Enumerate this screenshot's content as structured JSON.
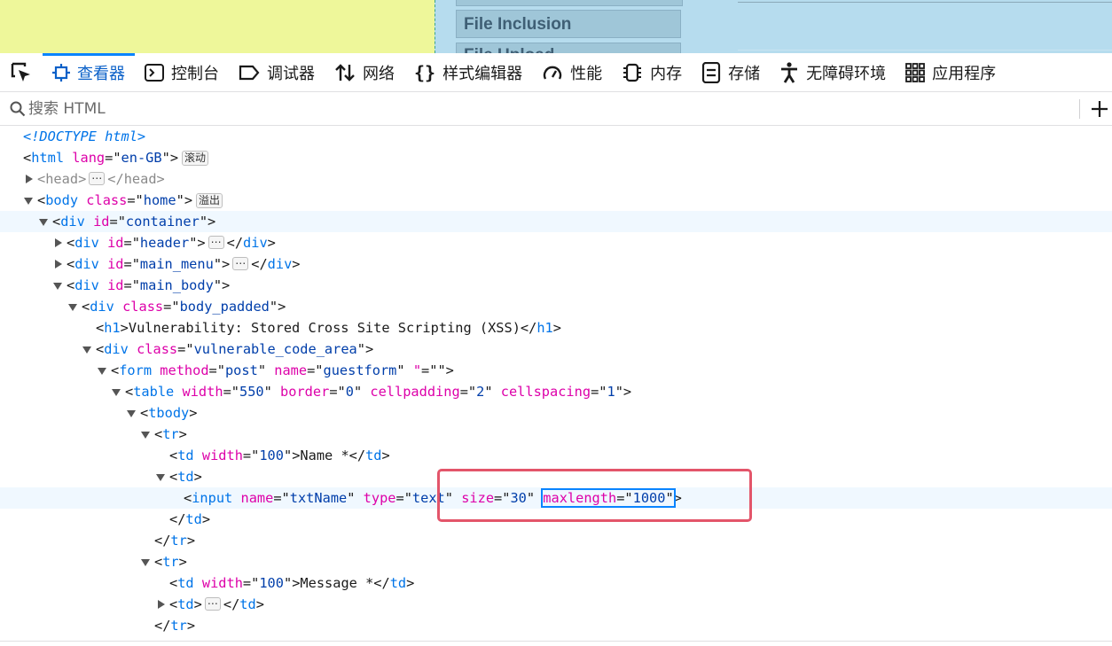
{
  "preview": {
    "menu_item": "File Inclusion",
    "menu_item_next": "File Upload"
  },
  "toolbar": {
    "tabs": [
      {
        "label": "查看器",
        "icon": "inspector-icon",
        "active": true
      },
      {
        "label": "控制台",
        "icon": "console-icon",
        "active": false
      },
      {
        "label": "调试器",
        "icon": "debugger-icon",
        "active": false
      },
      {
        "label": "网络",
        "icon": "network-icon",
        "active": false
      },
      {
        "label": "样式编辑器",
        "icon": "style-editor-icon",
        "active": false
      },
      {
        "label": "性能",
        "icon": "performance-icon",
        "active": false
      },
      {
        "label": "内存",
        "icon": "memory-icon",
        "active": false
      },
      {
        "label": "存储",
        "icon": "storage-icon",
        "active": false
      },
      {
        "label": "无障碍环境",
        "icon": "accessibility-icon",
        "active": false
      },
      {
        "label": "应用程序",
        "icon": "application-icon",
        "active": false
      }
    ]
  },
  "search": {
    "placeholder": "搜索 HTML"
  },
  "badges": {
    "scroll": "滚动",
    "overflow": "溢出",
    "ellipsis": "⋯"
  },
  "colors": {
    "accent": "#0a84ff",
    "tag": "#0074e8",
    "attr_name": "#dd00a9",
    "attr_value": "#003eaa",
    "annotation_box": "#e3556a"
  },
  "tree": {
    "doctype": "<!DOCTYPE html>",
    "html": {
      "tag": "html",
      "attr": "lang",
      "value": "en-GB"
    },
    "head": {
      "tag": "head"
    },
    "body": {
      "tag": "body",
      "attr": "class",
      "value": "home"
    },
    "container": {
      "tag": "div",
      "attr": "id",
      "value": "container"
    },
    "header": {
      "tag": "div",
      "attr": "id",
      "value": "header"
    },
    "main_menu": {
      "tag": "div",
      "attr": "id",
      "value": "main_menu"
    },
    "main_body": {
      "tag": "div",
      "attr": "id",
      "value": "main_body"
    },
    "body_padded": {
      "tag": "div",
      "attr": "class",
      "value": "body_padded"
    },
    "h1": {
      "tag": "h1",
      "text": "Vulnerability: Stored Cross Site Scripting (XSS)"
    },
    "code_area": {
      "tag": "div",
      "attr": "class",
      "value": "vulnerable_code_area"
    },
    "form": {
      "tag": "form",
      "a1": "method",
      "v1": "post",
      "a2": "name",
      "v2": "guestform",
      "a3": "\"",
      "v3": ""
    },
    "table": {
      "tag": "table",
      "a1": "width",
      "v1": "550",
      "a2": "border",
      "v2": "0",
      "a3": "cellpadding",
      "v3": "2",
      "a4": "cellspacing",
      "v4": "1"
    },
    "tbody": {
      "tag": "tbody"
    },
    "tr": {
      "tag": "tr"
    },
    "td": {
      "tag": "td"
    },
    "td_width_attr": "width",
    "td_width_value": "100",
    "name_label": "Name *",
    "message_label": "Message *",
    "input": {
      "tag": "input",
      "a1": "name",
      "v1": "txtName",
      "a2": "type",
      "v2": "text",
      "a3": "size",
      "v3": "30",
      "a4": "maxlength",
      "v4": "1000"
    }
  }
}
